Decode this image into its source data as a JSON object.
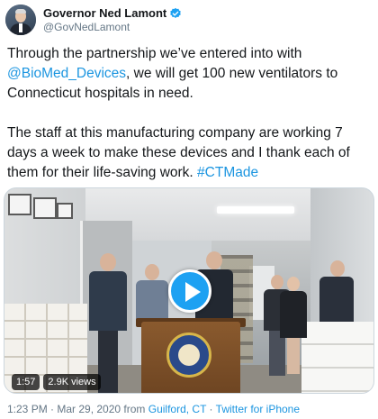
{
  "author": {
    "display_name": "Governor Ned Lamont",
    "handle": "@GovNedLamont",
    "verified": true
  },
  "tweet": {
    "paragraph1": {
      "before_mention": "Through the partnership we’ve entered into with ",
      "mention": "@BioMed_Devices",
      "after_mention": ", we will get 100 new ventilators to Connecticut hospitals in need."
    },
    "paragraph2": {
      "text": "The staff at this manufacturing company are working 7 days a week to make these devices and I thank each of them for their life-saving work. ",
      "hashtag": "#CTMade"
    }
  },
  "video": {
    "duration": "1:57",
    "views": "2.9K views",
    "play_icon": "play-icon"
  },
  "footer": {
    "time_date": "1:23 PM · Mar 29, 2020 from ",
    "location": "Guilford, CT",
    "separator": " · ",
    "source": "Twitter for iPhone"
  },
  "colors": {
    "link": "#1b95e0",
    "play_button": "#1da1f2",
    "muted_text": "#657786"
  }
}
